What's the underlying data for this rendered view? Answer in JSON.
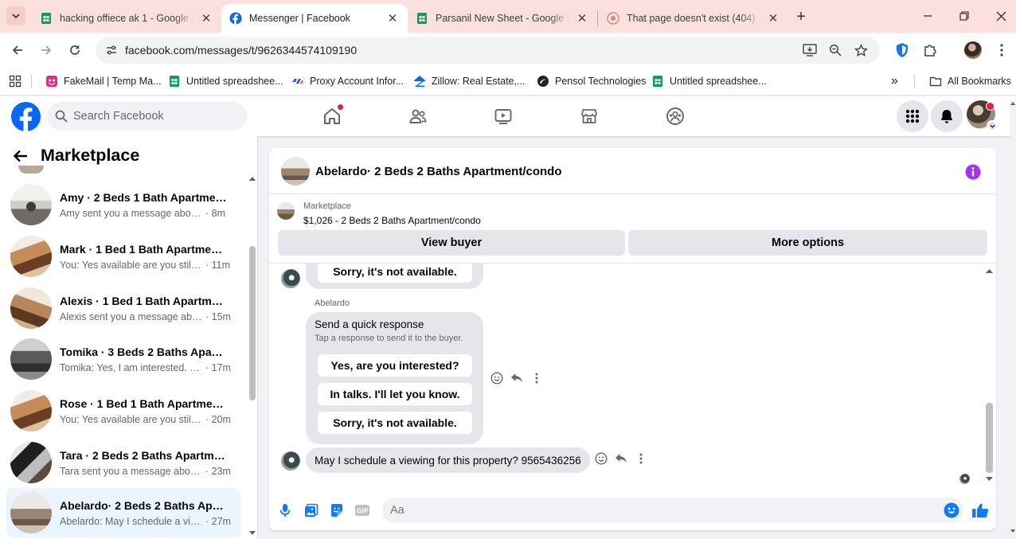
{
  "browser": {
    "tabs": [
      {
        "title": "hacking offiece ak 1 - Google Sheets",
        "icon": "sheets-icon",
        "active": false
      },
      {
        "title": "Messenger | Facebook",
        "icon": "facebook-icon",
        "active": true
      },
      {
        "title": "Parsanil New Sheet - Google Sheets",
        "icon": "sheets-icon",
        "active": false
      },
      {
        "title": "That page doesn't exist (404) - Facebook",
        "icon": "error-page-icon",
        "active": false
      }
    ],
    "url": "facebook.com/messages/t/9626344574109190",
    "bookmarks": [
      {
        "label": "FakeMail | Temp Ma...",
        "icon": "fakemail-icon"
      },
      {
        "label": "Untitled spreadshee...",
        "icon": "sheets-icon"
      },
      {
        "label": "Proxy Account Infor...",
        "icon": "proxy-icon"
      },
      {
        "label": "Zillow: Real Estate,...",
        "icon": "zillow-icon"
      },
      {
        "label": "Pensol Technologies",
        "icon": "pensol-icon"
      },
      {
        "label": "Untitled spreadshee...",
        "icon": "sheets-icon"
      }
    ],
    "bookmarks_more": "»",
    "all_bookmarks": "All Bookmarks"
  },
  "facebook": {
    "search_placeholder": "Search Facebook"
  },
  "sidebar": {
    "title": "Marketplace",
    "conversations": [
      {
        "name": "Amy · 2 Beds 1 Bath Apartment/condo",
        "preview": "Amy sent you a message about your listing",
        "time": "· 8m",
        "selected": false
      },
      {
        "name": "Mark · 1 Bed 1 Bath Apartment/condo",
        "preview": "You: Yes available are you still interested?",
        "time": "· 11m",
        "selected": false
      },
      {
        "name": "Alexis · 1 Bed 1 Bath Apartment/condo",
        "preview": "Alexis sent you a message about your listing",
        "time": "· 15m",
        "selected": false
      },
      {
        "name": "Tomika · 3 Beds 2 Baths Apartment/condo",
        "preview": "Tomika: Yes, I am interested. My number is",
        "time": "· 17m",
        "selected": false
      },
      {
        "name": "Rose · 1 Bed 1 Bath Apartment/condo",
        "preview": "You: Yes available are you still interested?",
        "time": "· 20m",
        "selected": false
      },
      {
        "name": "Tara · 2 Beds 2 Baths Apartment/condo",
        "preview": "Tara sent you a message about your listing",
        "time": "· 23m",
        "selected": false
      },
      {
        "name": "Abelardo· 2 Beds 2 Baths Apartment/condo",
        "preview": "Abelardo: May I schedule a viewing for this property?",
        "time": "· 27m",
        "selected": true
      }
    ]
  },
  "chat": {
    "title": "Abelardo· 2 Beds 2 Baths Apartment/condo",
    "listing": {
      "category": "Marketplace",
      "summary": "$1,026 - 2 Beds 2 Baths Apartment/condo"
    },
    "view_buyer": "View buyer",
    "more_options": "More options",
    "messages": {
      "top_partial_reply": "Sorry, it's not available.",
      "sender": "Abelardo",
      "quick": {
        "title": "Send a quick response",
        "subtitle": "Tap a response to send it to the buyer.",
        "options": [
          "Yes, are you interested?",
          "In talks. I'll let you know.",
          "Sorry, it's not available."
        ]
      },
      "last_message": "May I schedule a viewing for this property? 9565436256"
    },
    "composer": {
      "placeholder": "Aa"
    }
  },
  "colors": {
    "fb_blue": "#0866ff",
    "messenger_blue": "#0a7cff",
    "info_purple": "#a033ff",
    "tab_strip": "#fbe0dd",
    "badge_red": "#e41e3f",
    "selected_row": "#ebf5ff"
  }
}
